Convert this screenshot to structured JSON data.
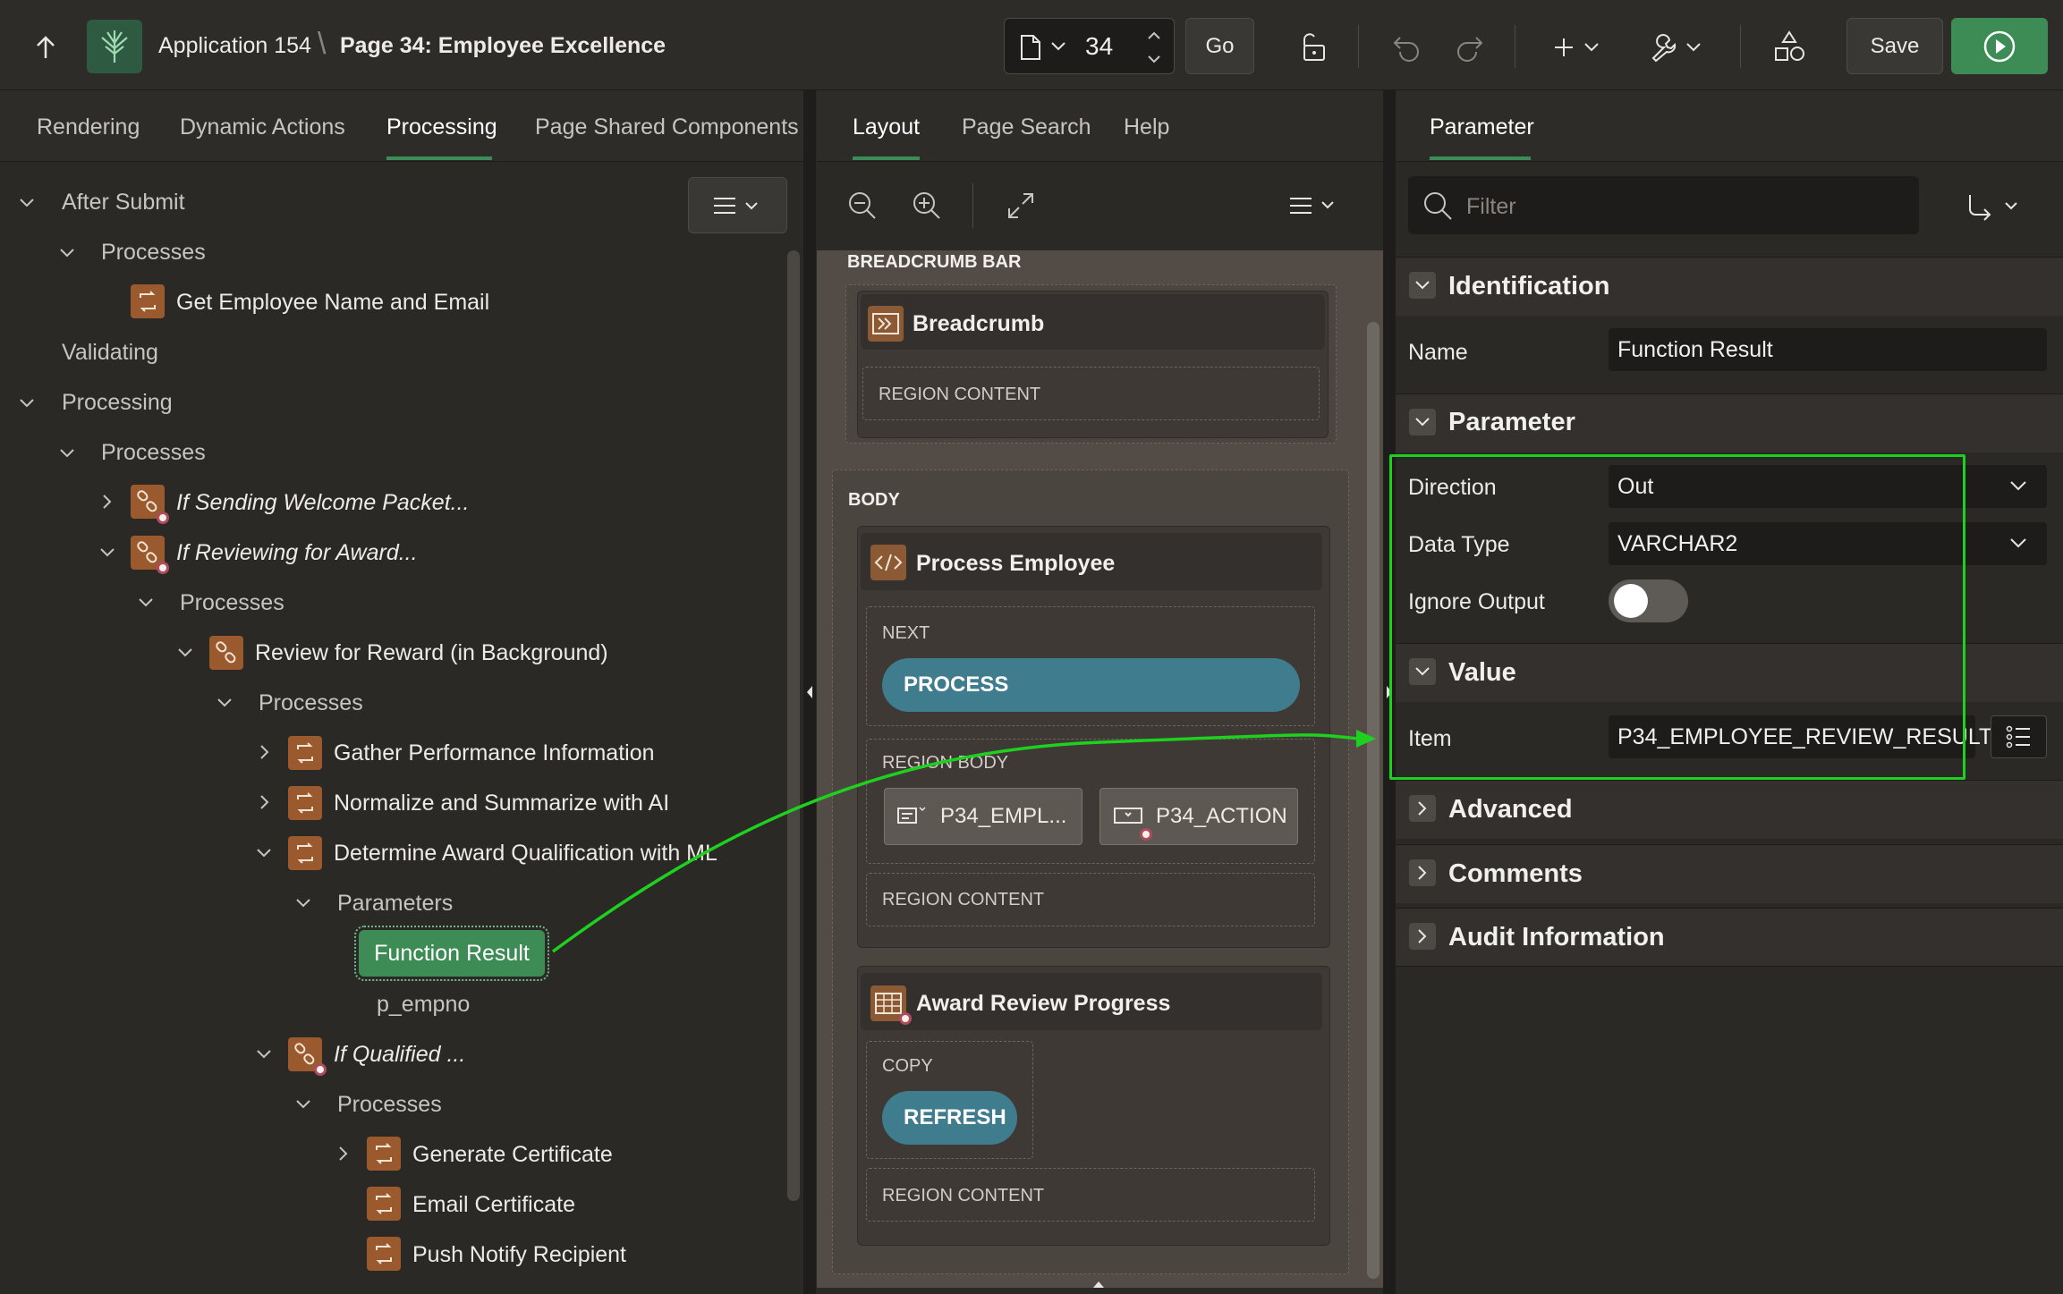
{
  "header": {
    "app_name": "Application 154",
    "page_title": "Page 34: Employee Excellence",
    "page_number": "34",
    "go_label": "Go",
    "save_label": "Save"
  },
  "left_panel": {
    "tabs": [
      "Rendering",
      "Dynamic Actions",
      "Processing",
      "Page Shared Components"
    ],
    "active_tab": "Processing",
    "tree": {
      "after_submit": "After Submit",
      "processes_1": "Processes",
      "get_employee": "Get Employee Name and Email",
      "validating": "Validating",
      "processing": "Processing",
      "processes_2": "Processes",
      "if_sending": "If Sending Welcome Packet...",
      "if_reviewing": "If Reviewing for Award...",
      "processes_3": "Processes",
      "review_for_reward": "Review for Reward (in Background)",
      "processes_4": "Processes",
      "gather_performance": "Gather Performance Information",
      "normalize": "Normalize and Summarize with AI",
      "determine_award": "Determine Award Qualification with ML",
      "parameters": "Parameters",
      "function_result": "Function Result",
      "p_empno": "p_empno",
      "if_qualified": "If Qualified ...",
      "processes_5": "Processes",
      "generate_certificate": "Generate Certificate",
      "email_certificate": "Email Certificate",
      "push_notify": "Push Notify Recipient"
    }
  },
  "middle_panel": {
    "tabs": [
      "Layout",
      "Page Search",
      "Help"
    ],
    "active_tab": "Layout",
    "breadcrumb_bar_label": "BREADCRUMB BAR",
    "breadcrumb_region": "Breadcrumb",
    "region_content": "REGION CONTENT",
    "body_label": "BODY",
    "process_employee": "Process Employee",
    "next_label": "NEXT",
    "process_button": "PROCESS",
    "region_body_label": "REGION BODY",
    "item_empl": "P34_EMPL...",
    "item_action": "P34_ACTION",
    "award_review": "Award Review Progress",
    "copy_label": "COPY",
    "refresh_button": "REFRESH"
  },
  "right_panel": {
    "tab": "Parameter",
    "filter_placeholder": "Filter",
    "identification": "Identification",
    "name_label": "Name",
    "name_value": "Function Result",
    "parameter": "Parameter",
    "direction_label": "Direction",
    "direction_value": "Out",
    "data_type_label": "Data Type",
    "data_type_value": "VARCHAR2",
    "ignore_output_label": "Ignore Output",
    "ignore_output_on": false,
    "value": "Value",
    "item_label": "Item",
    "item_value": "P34_EMPLOYEE_REVIEW_RESULT",
    "advanced": "Advanced",
    "comments": "Comments",
    "audit_information": "Audit Information"
  },
  "colors": {
    "accent_green": "#3d8c55",
    "annotation_green": "#1fd11f",
    "process_icon": "#9a5a2e",
    "pill_blue": "#3f7d8e"
  }
}
